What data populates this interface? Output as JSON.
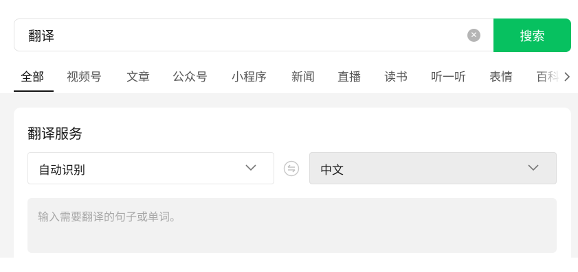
{
  "search": {
    "value": "翻译",
    "button_label": "搜索",
    "clear_icon": "clear-circle-icon"
  },
  "tabs": [
    {
      "label": "全部",
      "active": true
    },
    {
      "label": "视频号"
    },
    {
      "label": "文章"
    },
    {
      "label": "公众号"
    },
    {
      "label": "小程序"
    },
    {
      "label": "新闻"
    },
    {
      "label": "直播"
    },
    {
      "label": "读书"
    },
    {
      "label": "听一听"
    },
    {
      "label": "表情"
    },
    {
      "label": "百科"
    }
  ],
  "translate": {
    "title": "翻译服务",
    "source_language": "自动识别",
    "target_language": "中文",
    "input_placeholder": "输入需要翻译的句子或单词。"
  },
  "colors": {
    "accent": "#07c160",
    "page_bg": "#f4f4f4"
  }
}
